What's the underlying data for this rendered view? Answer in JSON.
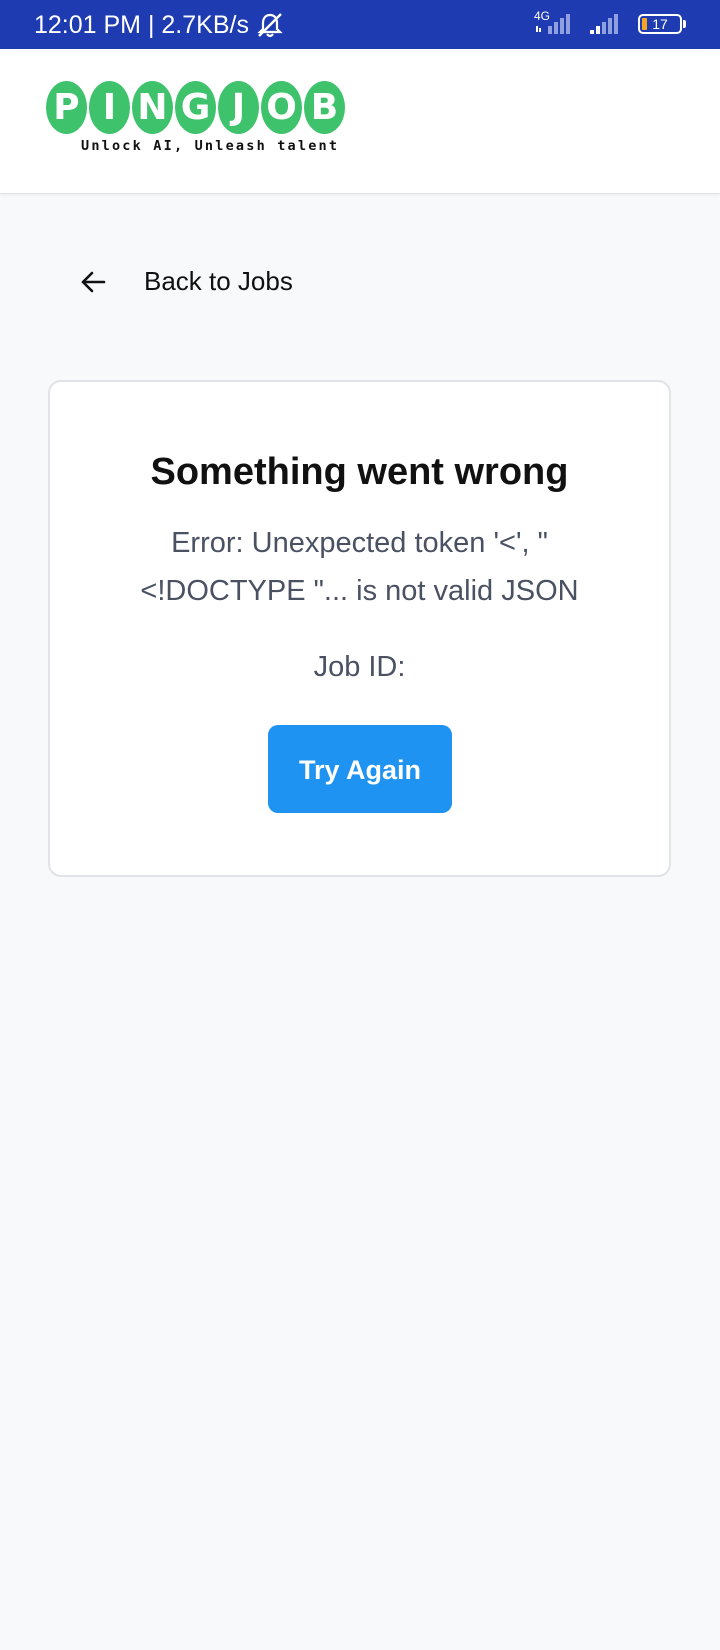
{
  "status_bar": {
    "time_speed": "12:01 PM | 2.7KB/s",
    "network": "4G",
    "battery": "17",
    "background": "#1f3bb1"
  },
  "header": {
    "logo_letters": [
      "P",
      "I",
      "N",
      "G",
      "J",
      "O",
      "B"
    ],
    "tagline": "Unlock AI, Unleash talent",
    "logo_color": "#3ec26b"
  },
  "nav": {
    "back_label": "Back to Jobs",
    "back_icon": "arrow-left-icon"
  },
  "error_card": {
    "title": "Something went wrong",
    "message": "Error: Unexpected token '<', \" <!DOCTYPE \"... is not valid JSON",
    "job_id_label": "Job ID:",
    "retry_label": "Try Again",
    "button_color": "#1f93f2"
  }
}
